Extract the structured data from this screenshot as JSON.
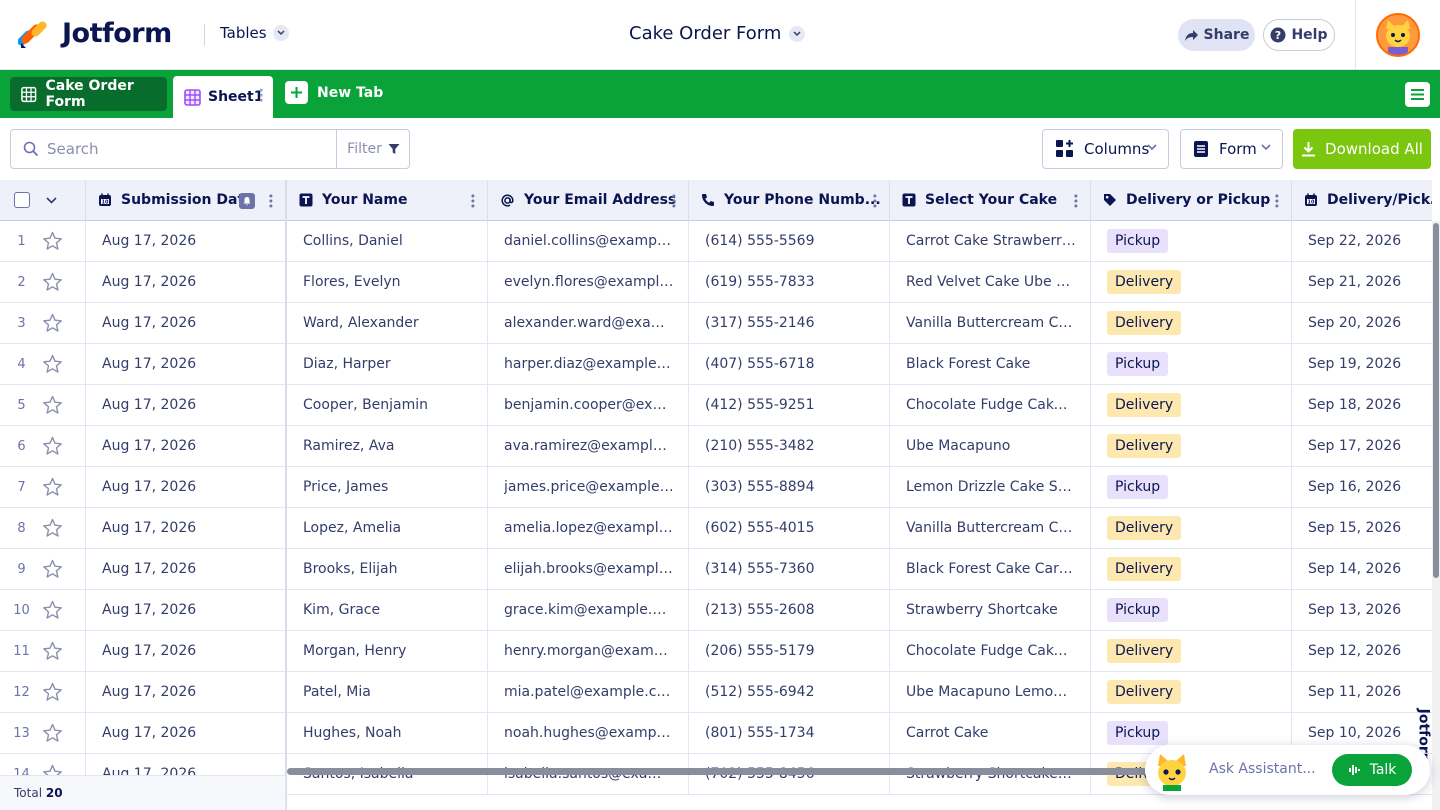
{
  "app": {
    "logo_text": "Jotform",
    "section": "Tables",
    "title": "Cake Order Form",
    "share_label": "Share",
    "help_label": "Help"
  },
  "tabs": {
    "form_tab": "Cake Order Form",
    "sheet_tab": "Sheet1",
    "new_tab": "New Tab"
  },
  "toolbar": {
    "search_placeholder": "Search",
    "filter_label": "Filter",
    "columns_label": "Columns",
    "form_label": "Form",
    "download_label": "Download All"
  },
  "columns": [
    {
      "label": "Submission Date",
      "icon": "calendar-icon"
    },
    {
      "label": "Your Name",
      "icon": "text-icon"
    },
    {
      "label": "Your Email Address",
      "icon": "at-icon"
    },
    {
      "label": "Your Phone Numb...",
      "icon": "phone-icon"
    },
    {
      "label": "Select Your Cake",
      "icon": "text-icon"
    },
    {
      "label": "Delivery or Pickup",
      "icon": "tag-icon"
    },
    {
      "label": "Delivery/Pickup ...",
      "icon": "calendar-icon"
    }
  ],
  "rows": [
    {
      "num": "1",
      "date": "Aug 17, 2026",
      "name": "Collins, Daniel",
      "email": "daniel.collins@example....",
      "phone": "(614) 555-5569",
      "cake": "Carrot Cake Strawberry ...",
      "method": "Pickup",
      "pickup_date": "Sep 22, 2026"
    },
    {
      "num": "2",
      "date": "Aug 17, 2026",
      "name": "Flores, Evelyn",
      "email": "evelyn.flores@example.c...",
      "phone": "(619) 555-7833",
      "cake": "Red Velvet Cake Ube Ma...",
      "method": "Delivery",
      "pickup_date": "Sep 21, 2026"
    },
    {
      "num": "3",
      "date": "Aug 17, 2026",
      "name": "Ward, Alexander",
      "email": "alexander.ward@exampl...",
      "phone": "(317) 555-2146",
      "cake": "Vanilla Buttercream Cak...",
      "method": "Delivery",
      "pickup_date": "Sep 20, 2026"
    },
    {
      "num": "4",
      "date": "Aug 17, 2026",
      "name": "Diaz, Harper",
      "email": "harper.diaz@example.com",
      "phone": "(407) 555-6718",
      "cake": "Black Forest Cake",
      "method": "Pickup",
      "pickup_date": "Sep 19, 2026"
    },
    {
      "num": "5",
      "date": "Aug 17, 2026",
      "name": "Cooper, Benjamin",
      "email": "benjamin.cooper@exam...",
      "phone": "(412) 555-9251",
      "cake": "Chocolate Fudge Cake ...",
      "method": "Delivery",
      "pickup_date": "Sep 18, 2026"
    },
    {
      "num": "6",
      "date": "Aug 17, 2026",
      "name": "Ramirez, Ava",
      "email": "ava.ramirez@example.c...",
      "phone": "(210) 555-3482",
      "cake": "Ube Macapuno",
      "method": "Delivery",
      "pickup_date": "Sep 17, 2026"
    },
    {
      "num": "7",
      "date": "Aug 17, 2026",
      "name": "Price, James",
      "email": "james.price@example.c...",
      "phone": "(303) 555-8894",
      "cake": "Lemon Drizzle Cake Stra...",
      "method": "Pickup",
      "pickup_date": "Sep 16, 2026"
    },
    {
      "num": "8",
      "date": "Aug 17, 2026",
      "name": "Lopez, Amelia",
      "email": "amelia.lopez@example.c...",
      "phone": "(602) 555-4015",
      "cake": "Vanilla Buttercream Cak...",
      "method": "Delivery",
      "pickup_date": "Sep 15, 2026"
    },
    {
      "num": "9",
      "date": "Aug 17, 2026",
      "name": "Brooks, Elijah",
      "email": "elijah.brooks@example.c...",
      "phone": "(314) 555-7360",
      "cake": "Black Forest Cake Carro...",
      "method": "Delivery",
      "pickup_date": "Sep 14, 2026"
    },
    {
      "num": "10",
      "date": "Aug 17, 2026",
      "name": "Kim, Grace",
      "email": "grace.kim@example.com",
      "phone": "(213) 555-2608",
      "cake": "Strawberry Shortcake",
      "method": "Pickup",
      "pickup_date": "Sep 13, 2026"
    },
    {
      "num": "11",
      "date": "Aug 17, 2026",
      "name": "Morgan, Henry",
      "email": "henry.morgan@example....",
      "phone": "(206) 555-5179",
      "cake": "Chocolate Fudge Cake ...",
      "method": "Delivery",
      "pickup_date": "Sep 12, 2026"
    },
    {
      "num": "12",
      "date": "Aug 17, 2026",
      "name": "Patel, Mia",
      "email": "mia.patel@example.com",
      "phone": "(512) 555-6942",
      "cake": "Ube Macapuno Lemon ...",
      "method": "Delivery",
      "pickup_date": "Sep 11, 2026"
    },
    {
      "num": "13",
      "date": "Aug 17, 2026",
      "name": "Hughes, Noah",
      "email": "noah.hughes@example....",
      "phone": "(801) 555-1734",
      "cake": "Carrot Cake",
      "method": "Pickup",
      "pickup_date": "Sep 10, 2026"
    },
    {
      "num": "14",
      "date": "Aug 17, 2026",
      "name": "Santos, Isabella",
      "email": "isabella.santos@exampl...",
      "phone": "(702) 555-8456",
      "cake": "Strawberry Shortcake V...",
      "method": "Delivery",
      "pickup_date": "Sep 9, 2026"
    }
  ],
  "footer": {
    "total_label": "Total",
    "total_count": "20"
  },
  "assistant": {
    "placeholder": "Ask Assistant...",
    "talk_label": "Talk"
  },
  "side_brand": "Jotform",
  "colors": {
    "brand_green": "#0aa33a",
    "dark_green": "#086d2c",
    "download_green": "#7bc60e",
    "navy": "#0a1551",
    "pickup_badge": "#e9e1fb",
    "delivery_badge": "#fde8b0"
  }
}
